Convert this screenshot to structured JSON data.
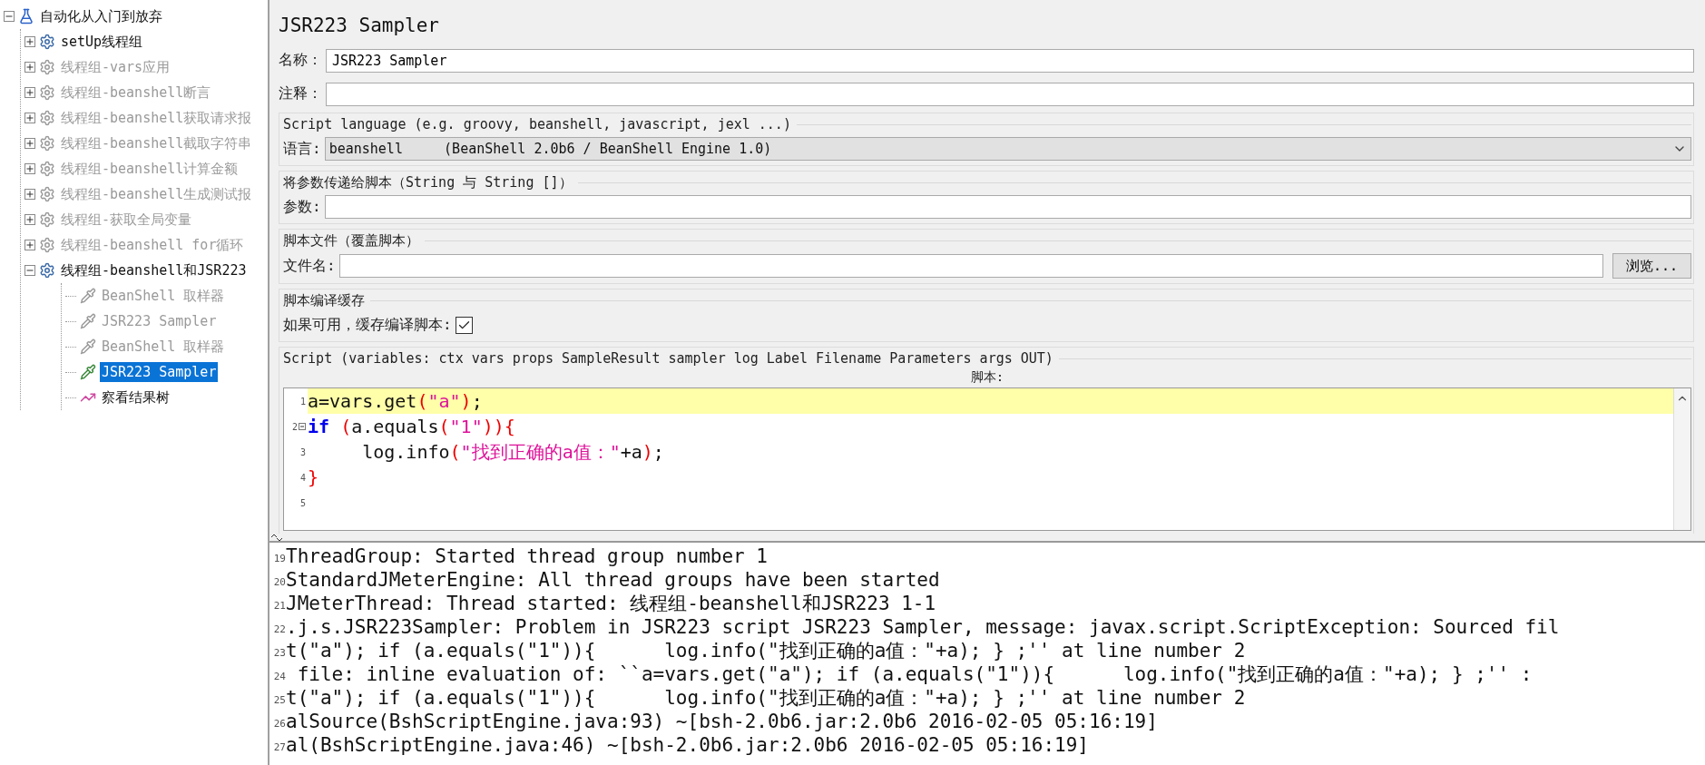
{
  "tree": {
    "items": [
      {
        "kind": "test-plan",
        "label": "自动化从入门到放弃",
        "expanded": true,
        "disabled": false,
        "selected": false,
        "children": [
          {
            "kind": "thread-group",
            "label": "setUp线程组",
            "expanded": false,
            "disabled": false,
            "selected": false
          },
          {
            "kind": "thread-group",
            "label": "线程组-vars应用",
            "expanded": false,
            "disabled": true,
            "selected": false
          },
          {
            "kind": "thread-group",
            "label": "线程组-beanshell断言",
            "expanded": false,
            "disabled": true,
            "selected": false
          },
          {
            "kind": "thread-group",
            "label": "线程组-beanshell获取请求报",
            "expanded": false,
            "disabled": true,
            "selected": false
          },
          {
            "kind": "thread-group",
            "label": "线程组-beanshell截取字符串",
            "expanded": false,
            "disabled": true,
            "selected": false
          },
          {
            "kind": "thread-group",
            "label": "线程组-beanshell计算金额",
            "expanded": false,
            "disabled": true,
            "selected": false
          },
          {
            "kind": "thread-group",
            "label": "线程组-beanshell生成测试报",
            "expanded": false,
            "disabled": true,
            "selected": false
          },
          {
            "kind": "thread-group",
            "label": "线程组-获取全局变量",
            "expanded": false,
            "disabled": true,
            "selected": false
          },
          {
            "kind": "thread-group",
            "label": "线程组-beanshell for循环",
            "expanded": false,
            "disabled": true,
            "selected": false
          },
          {
            "kind": "thread-group",
            "label": "线程组-beanshell和JSR223",
            "expanded": true,
            "disabled": false,
            "selected": false,
            "children": [
              {
                "kind": "sampler",
                "label": "BeanShell 取样器",
                "disabled": true,
                "selected": false
              },
              {
                "kind": "sampler",
                "label": "JSR223 Sampler",
                "disabled": true,
                "selected": false
              },
              {
                "kind": "sampler",
                "label": "BeanShell 取样器",
                "disabled": true,
                "selected": false
              },
              {
                "kind": "sampler",
                "label": "JSR223 Sampler",
                "disabled": false,
                "selected": true
              },
              {
                "kind": "listener",
                "label": "察看结果树",
                "disabled": false,
                "selected": false
              }
            ]
          }
        ]
      }
    ]
  },
  "panel": {
    "title": "JSR223 Sampler",
    "name": {
      "label": "名称：",
      "value": "JSR223 Sampler"
    },
    "comment": {
      "label": "注释："
    },
    "language_group": {
      "legend": "Script language (e.g. groovy, beanshell, javascript, jexl ...)",
      "label": "语言:",
      "value": "beanshell     (BeanShell 2.0b6 / BeanShell Engine 1.0)"
    },
    "params_group": {
      "legend": "将参数传递给脚本（String 与 String []）",
      "label": "参数:"
    },
    "file_group": {
      "legend": "脚本文件（覆盖脚本）",
      "label": "文件名:",
      "button": "浏览..."
    },
    "cache_group": {
      "legend": "脚本编译缓存",
      "label": "如果可用，缓存编译脚本:",
      "checked": true
    },
    "script_group": {
      "legend": "Script (variables: ctx vars props SampleResult sampler log Label Filename Parameters args OUT)",
      "editor_label": "脚本:",
      "lines": [
        {
          "number": "1",
          "current": true,
          "fold": false,
          "tokens": [
            {
              "kind": "plain",
              "text": "a=vars.get"
            },
            {
              "kind": "paren",
              "text": "("
            },
            {
              "kind": "string",
              "text": "\"a\""
            },
            {
              "kind": "paren",
              "text": ")"
            },
            {
              "kind": "plain",
              "text": ";"
            }
          ]
        },
        {
          "number": "2",
          "current": false,
          "fold": true,
          "tokens": [
            {
              "kind": "keyword",
              "text": "if"
            },
            {
              "kind": "paren",
              "text": " ("
            },
            {
              "kind": "plain",
              "text": "a.equals"
            },
            {
              "kind": "paren",
              "text": "("
            },
            {
              "kind": "string",
              "text": "\"1\""
            },
            {
              "kind": "paren",
              "text": "))"
            },
            {
              "kind": "paren",
              "text": "{"
            }
          ]
        },
        {
          "number": "3",
          "current": false,
          "fold": false,
          "tokens": [
            {
              "kind": "plain",
              "text": "     log.info"
            },
            {
              "kind": "paren",
              "text": "("
            },
            {
              "kind": "string",
              "text": "\"找到正确的a值：\""
            },
            {
              "kind": "plain",
              "text": "+a"
            },
            {
              "kind": "paren",
              "text": ")"
            },
            {
              "kind": "plain",
              "text": ";"
            }
          ]
        },
        {
          "number": "4",
          "current": false,
          "fold": false,
          "tokens": [
            {
              "kind": "paren",
              "text": "}"
            }
          ]
        },
        {
          "number": "5",
          "current": false,
          "fold": false
        }
      ]
    }
  },
  "log": {
    "lines": [
      {
        "number": "19",
        "text": "ThreadGroup: Started thread group number 1"
      },
      {
        "number": "20",
        "text": "StandardJMeterEngine: All thread groups have been started"
      },
      {
        "number": "21",
        "text": "JMeterThread: Thread started: 线程组-beanshell和JSR223 1-1"
      },
      {
        "number": "22",
        "text": ".j.s.JSR223Sampler: Problem in JSR223 script JSR223 Sampler, message: javax.script.ScriptException: Sourced fil"
      },
      {
        "number": "23",
        "text": "t(\"a\"); if (a.equals(\"1\")){      log.info(\"找到正确的a值：\"+a); } ;'' at line number 2"
      },
      {
        "number": "24",
        "text": " file: inline evaluation of: ``a=vars.get(\"a\"); if (a.equals(\"1\")){      log.info(\"找到正确的a值：\"+a); } ;'' :"
      },
      {
        "number": "25",
        "text": "t(\"a\"); if (a.equals(\"1\")){      log.info(\"找到正确的a值：\"+a); } ;'' at line number 2"
      },
      {
        "number": "26",
        "text": "alSource(BshScriptEngine.java:93) ~[bsh-2.0b6.jar:2.0b6 2016-02-05 05:16:19]"
      },
      {
        "number": "27",
        "text": "al(BshScriptEngine.java:46) ~[bsh-2.0b6.jar:2.0b6 2016-02-05 05:16:19]"
      }
    ]
  }
}
